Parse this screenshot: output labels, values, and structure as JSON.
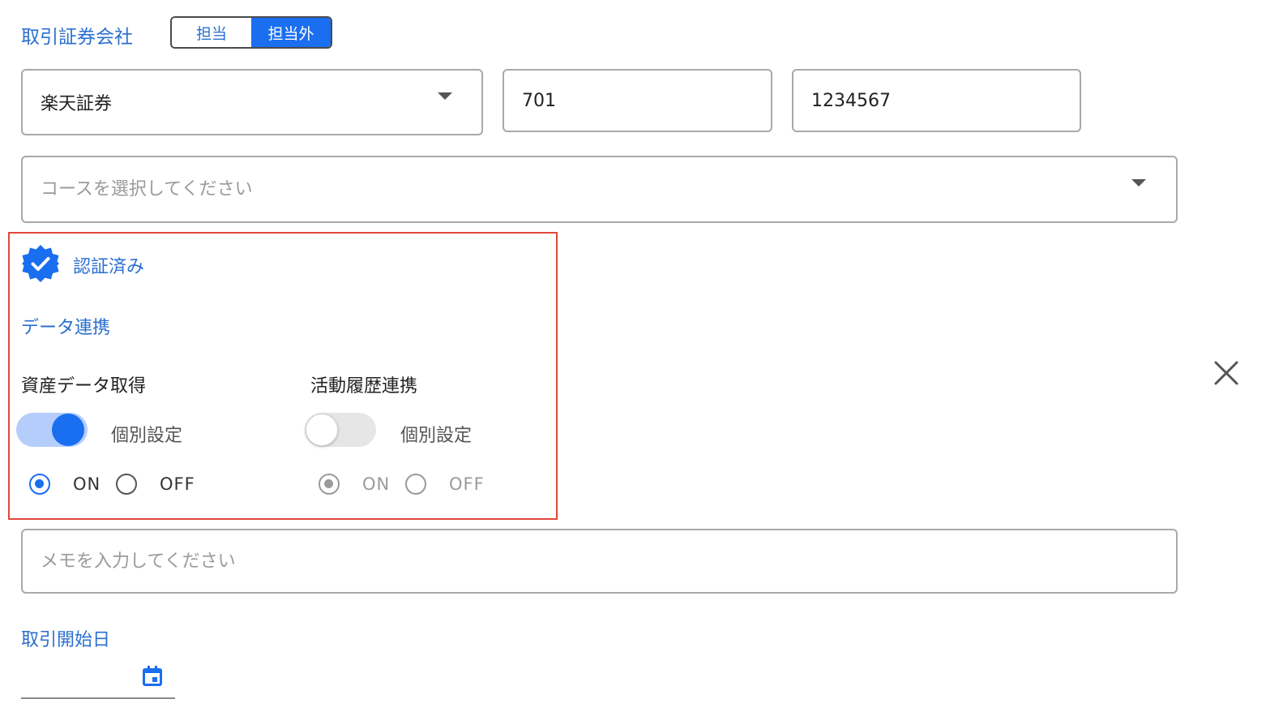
{
  "broker_section": {
    "title": "取引証券会社",
    "segment": {
      "options": [
        "担当",
        "担当外"
      ],
      "selected": "担当外"
    }
  },
  "broker_select": {
    "value": "楽天証券"
  },
  "branch_code": {
    "value": "701"
  },
  "account_number": {
    "value": "1234567"
  },
  "course_select": {
    "placeholder": "コースを選択してください"
  },
  "auth_status": {
    "label": "認証済み",
    "icon": "verified-badge-icon"
  },
  "data_link": {
    "title": "データ連携",
    "asset_data": {
      "label": "資産データ取得",
      "toggle_label": "個別設定",
      "toggle_on": true,
      "radio_on": "ON",
      "radio_off": "OFF",
      "selected": "ON"
    },
    "activity_history": {
      "label": "活動履歴連携",
      "toggle_label": "個別設定",
      "toggle_on": false,
      "radio_on": "ON",
      "radio_off": "OFF",
      "selected": "ON",
      "disabled": true
    }
  },
  "memo": {
    "placeholder": "メモを入力してください"
  },
  "start_date": {
    "label": "取引開始日",
    "value": ""
  },
  "colors": {
    "accent": "#1a6ef0",
    "label_blue": "#2a6fcf",
    "highlight_frame": "#e0473a"
  }
}
